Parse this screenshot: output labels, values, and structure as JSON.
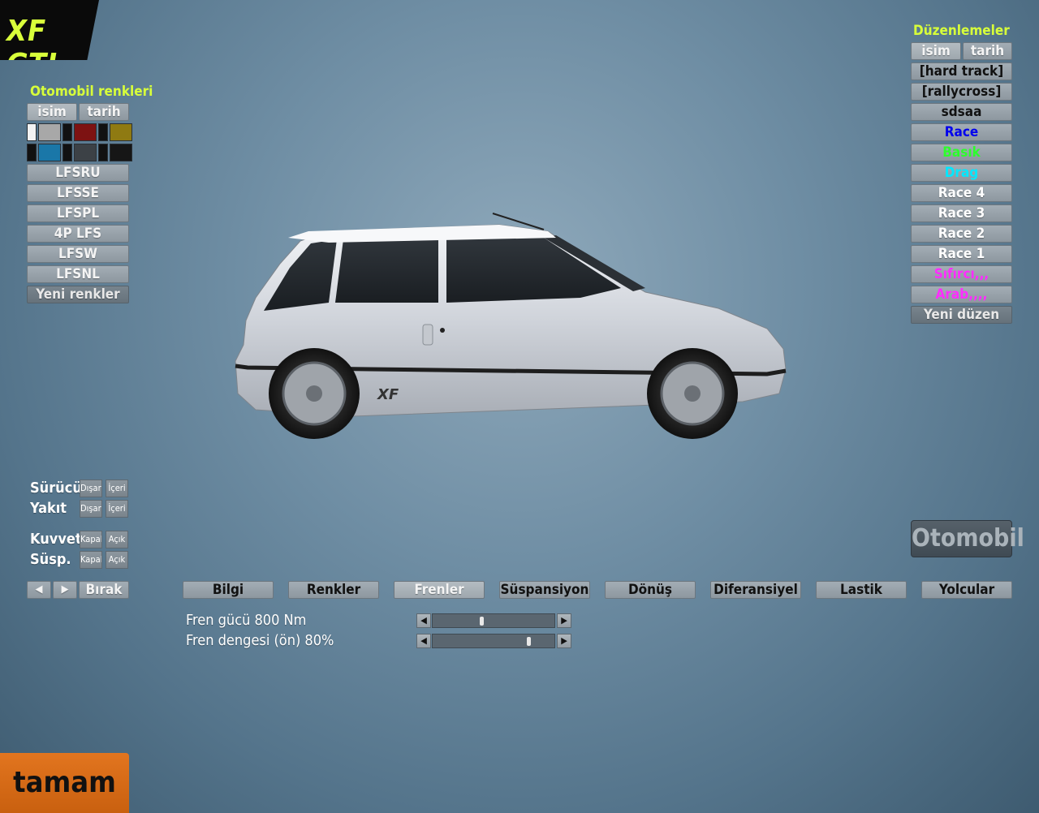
{
  "title": "XF GTI",
  "colors_panel": {
    "header": "Otomobil renkleri",
    "sort_name": "isim",
    "sort_date": "tarih",
    "swatches_row1": [
      "#f2f2f2",
      "#a8a8a8",
      "#111111",
      "#7d1212",
      "#111111",
      "#8f7a12"
    ],
    "swatches_row2": [
      "#111111",
      "#1a77a8",
      "#111111",
      "#3c4146",
      "#111111",
      "#161616"
    ],
    "items": [
      "LFSRU",
      "LFSSE",
      "LFSPL",
      "4P LFS",
      "LFSW",
      "LFSNL"
    ],
    "new_label": "Yeni renkler"
  },
  "setups_panel": {
    "header": "Düzenlemeler",
    "sort_name": "isim",
    "sort_date": "tarih",
    "items": [
      {
        "label": "[hard track]",
        "color": "#111111"
      },
      {
        "label": "[rallycross]",
        "color": "#111111"
      },
      {
        "label": "sdsaa",
        "color": "#111111"
      },
      {
        "label": "Race",
        "color": "#0000ee"
      },
      {
        "label": "Basık",
        "color": "#2cff2c"
      },
      {
        "label": "Drag",
        "color": "#00e8ff"
      },
      {
        "label": "Race 4",
        "color": "#ffffff"
      },
      {
        "label": "Race 3",
        "color": "#ffffff"
      },
      {
        "label": "Race 2",
        "color": "#ffffff"
      },
      {
        "label": "Race 1",
        "color": "#ffffff"
      },
      {
        "label": "Sıfırcı,,,",
        "color": "#ff2cff"
      },
      {
        "label": "Arab,,,,",
        "color": "#ff2cff"
      }
    ],
    "new_label": "Yeni düzen"
  },
  "options": {
    "driver_label": "Sürücü",
    "fuel_label": "Yakıt",
    "out_label": "Dışarı",
    "in_label": "İçeri",
    "force_label": "Kuvvet",
    "susp_label": "Süsp.",
    "off_label": "Kapalı",
    "on_label": "Açık",
    "prev_icon": "◀",
    "next_icon": "▶",
    "drop_label": "Bırak"
  },
  "tabs": [
    "Bilgi",
    "Renkler",
    "Frenler",
    "Süspansiyon",
    "Dönüş",
    "Diferansiyel",
    "Lastik",
    "Yolcular"
  ],
  "active_tab": "Frenler",
  "brakes": {
    "brake_force_label": "Fren gücü 800 Nm",
    "brake_force_fraction": 0.4,
    "brake_balance_label": "Fren dengesi (ön) 80%",
    "brake_balance_fraction": 0.8
  },
  "car_badge": "XF",
  "otomobil_label": "Otomobil",
  "ok_label": "tamam"
}
